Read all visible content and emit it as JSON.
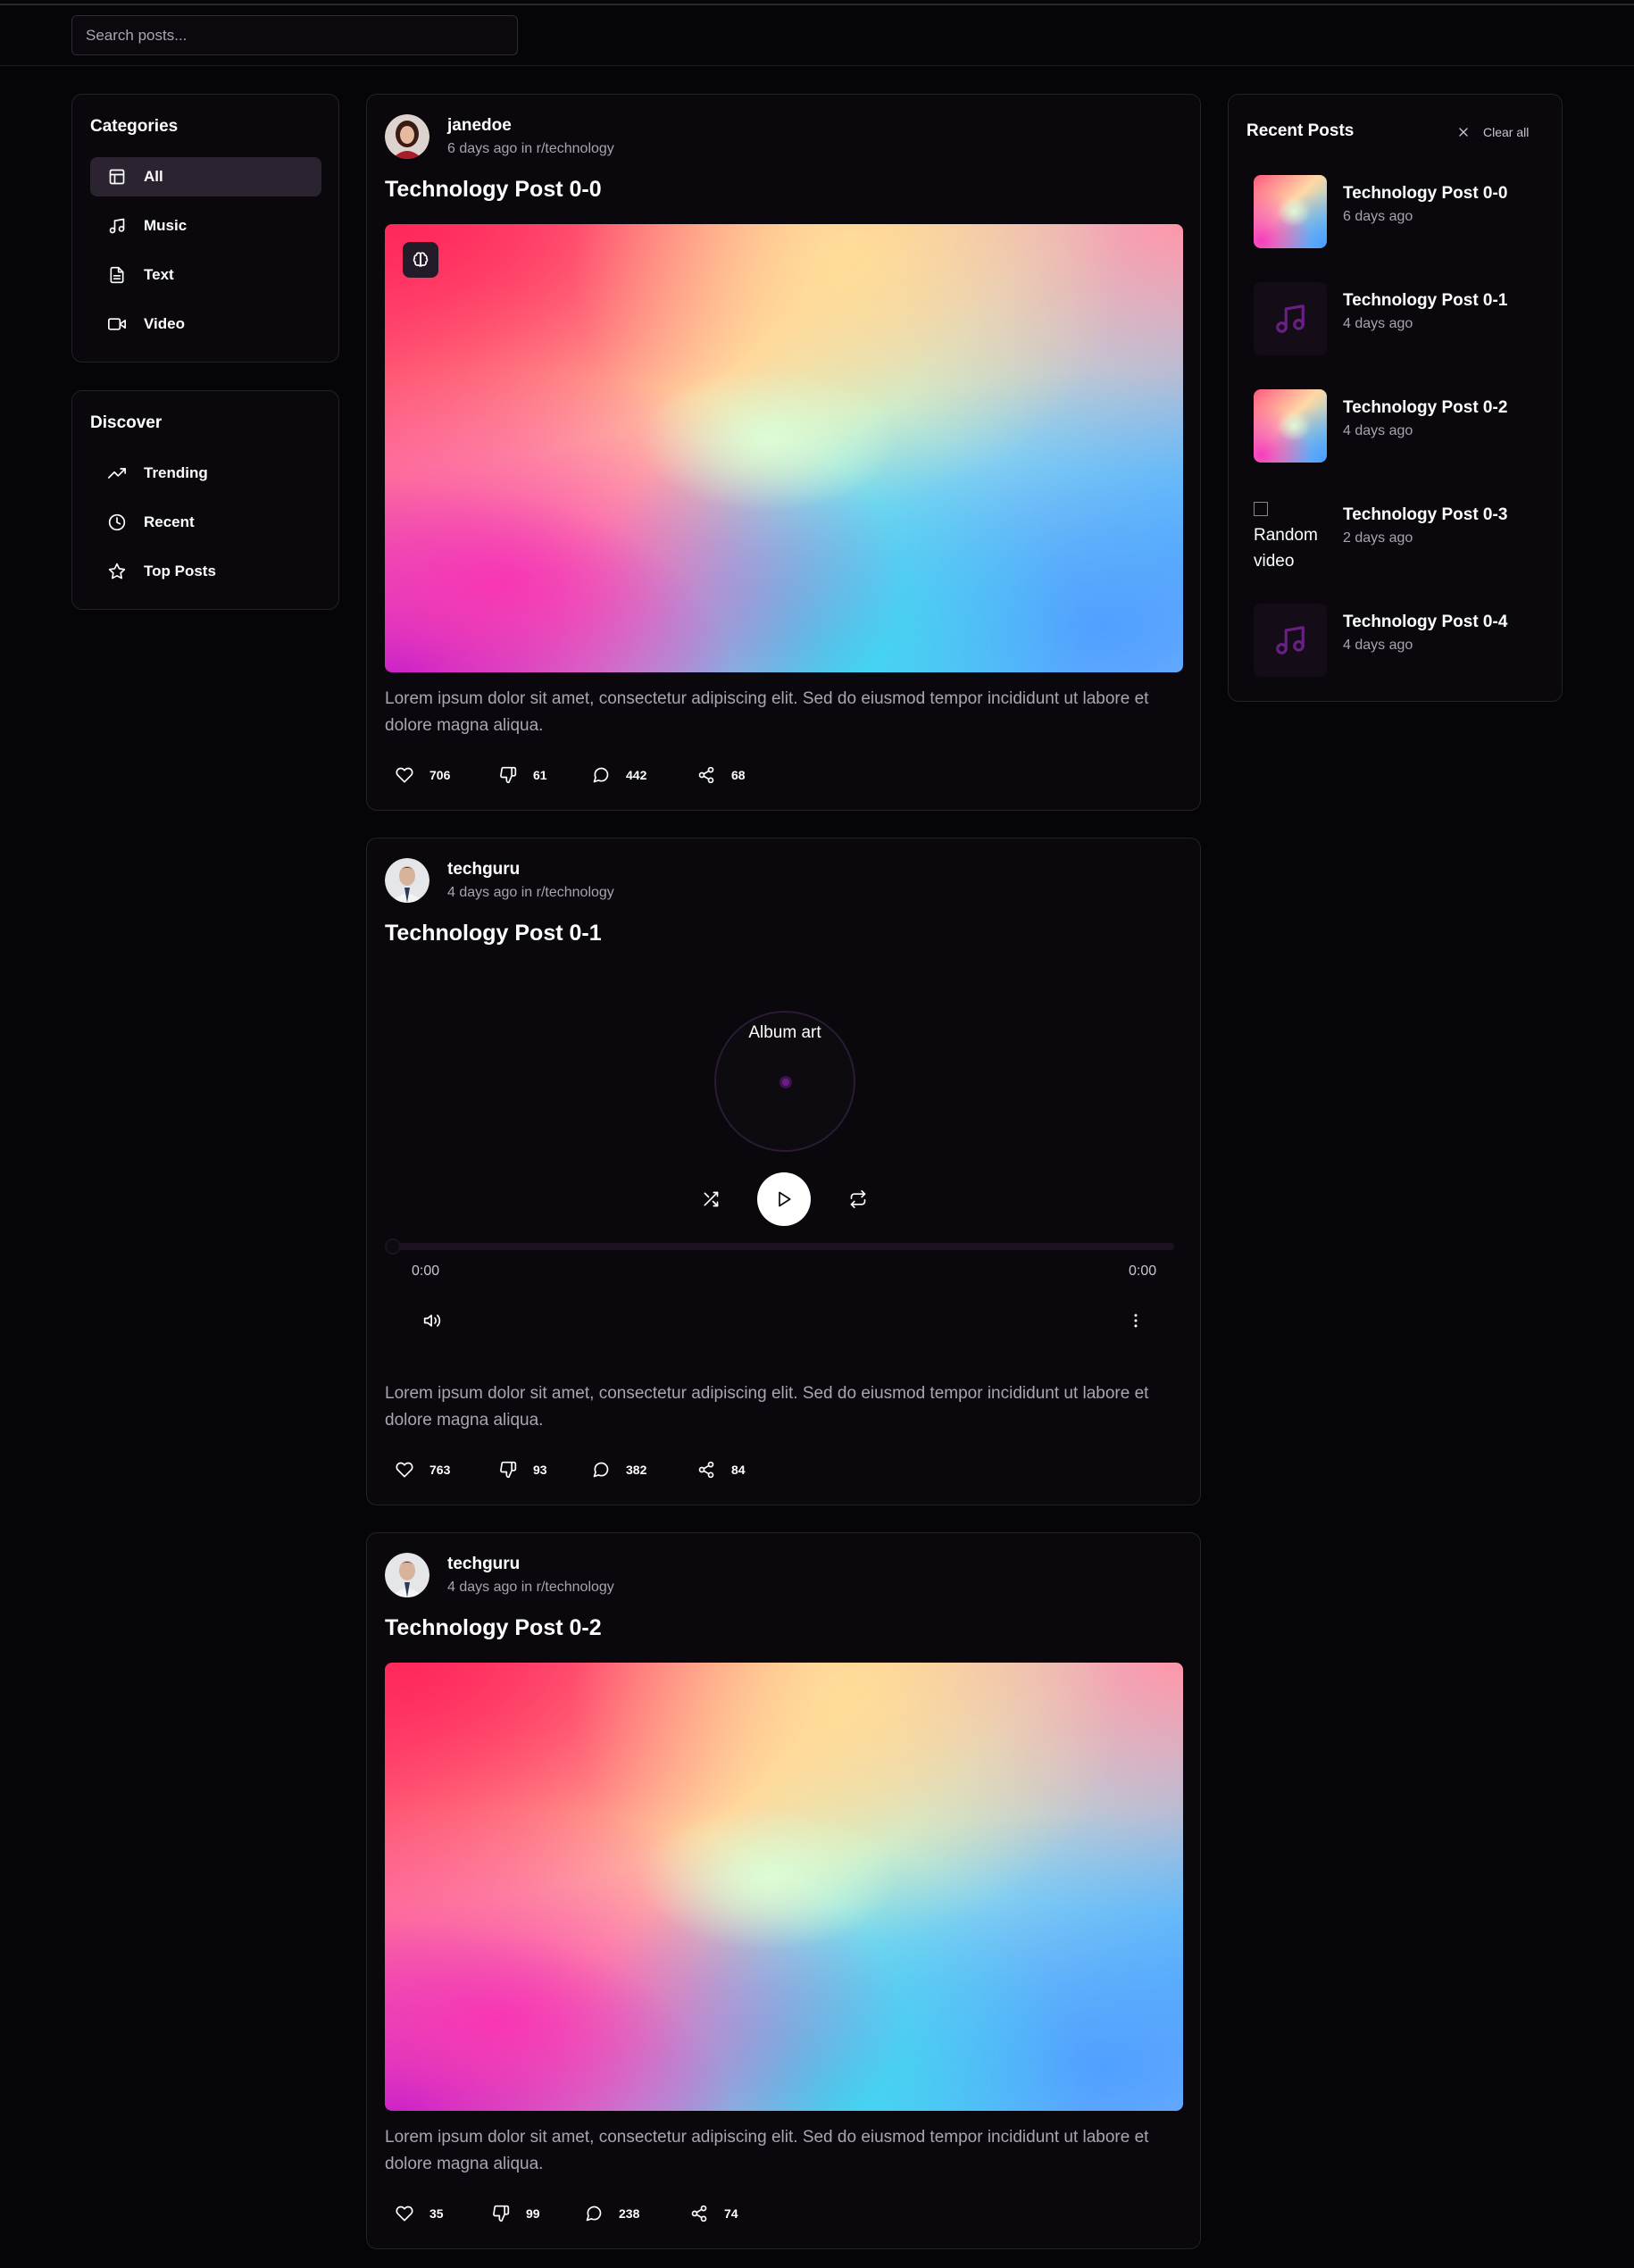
{
  "search": {
    "placeholder": "Search posts..."
  },
  "categories": {
    "title": "Categories",
    "items": [
      {
        "label": "All",
        "icon": "layout-icon",
        "active": true
      },
      {
        "label": "Music",
        "icon": "music-icon"
      },
      {
        "label": "Text",
        "icon": "document-icon"
      },
      {
        "label": "Video",
        "icon": "video-icon"
      }
    ]
  },
  "discover": {
    "title": "Discover",
    "items": [
      {
        "label": "Trending",
        "icon": "trending-icon"
      },
      {
        "label": "Recent",
        "icon": "clock-icon"
      },
      {
        "label": "Top Posts",
        "icon": "star-icon"
      }
    ]
  },
  "posts": [
    {
      "username": "janedoe",
      "meta": "6 days ago in r/technology",
      "title": "Technology Post 0-0",
      "media": "image",
      "body": "Lorem ipsum dolor sit amet, consectetur adipiscing elit. Sed do eiusmod tempor incididunt ut labore et dolore magna aliqua.",
      "likes": "706",
      "dislikes": "61",
      "comments": "442",
      "shares": "68"
    },
    {
      "username": "techguru",
      "meta": "4 days ago in r/technology",
      "title": "Technology Post 0-1",
      "media": "audio",
      "album_alt": "Album art",
      "time_current": "0:00",
      "time_total": "0:00",
      "body": "Lorem ipsum dolor sit amet, consectetur adipiscing elit. Sed do eiusmod tempor incididunt ut labore et dolore magna aliqua.",
      "likes": "763",
      "dislikes": "93",
      "comments": "382",
      "shares": "84"
    },
    {
      "username": "techguru",
      "meta": "4 days ago in r/technology",
      "title": "Technology Post 0-2",
      "media": "image",
      "body": "Lorem ipsum dolor sit amet, consectetur adipiscing elit. Sed do eiusmod tempor incididunt ut labore et dolore magna aliqua.",
      "likes": "35",
      "dislikes": "99",
      "comments": "238",
      "shares": "74"
    }
  ],
  "recent": {
    "title": "Recent Posts",
    "clear_label": "Clear all",
    "items": [
      {
        "title": "Technology Post 0-0",
        "date": "6 days ago",
        "thumb": "image"
      },
      {
        "title": "Technology Post 0-1",
        "date": "4 days ago",
        "thumb": "music"
      },
      {
        "title": "Technology Post 0-2",
        "date": "4 days ago",
        "thumb": "image"
      },
      {
        "title": "Technology Post 0-3",
        "date": "2 days ago",
        "thumb": "broken",
        "alt": "Random video"
      },
      {
        "title": "Technology Post 0-4",
        "date": "4 days ago",
        "thumb": "music"
      }
    ]
  },
  "colors": {
    "background": "#050406",
    "panel": "#0a080c",
    "border": "#24212b",
    "active": "#2b2430",
    "accent_purple": "#6b1f86"
  }
}
